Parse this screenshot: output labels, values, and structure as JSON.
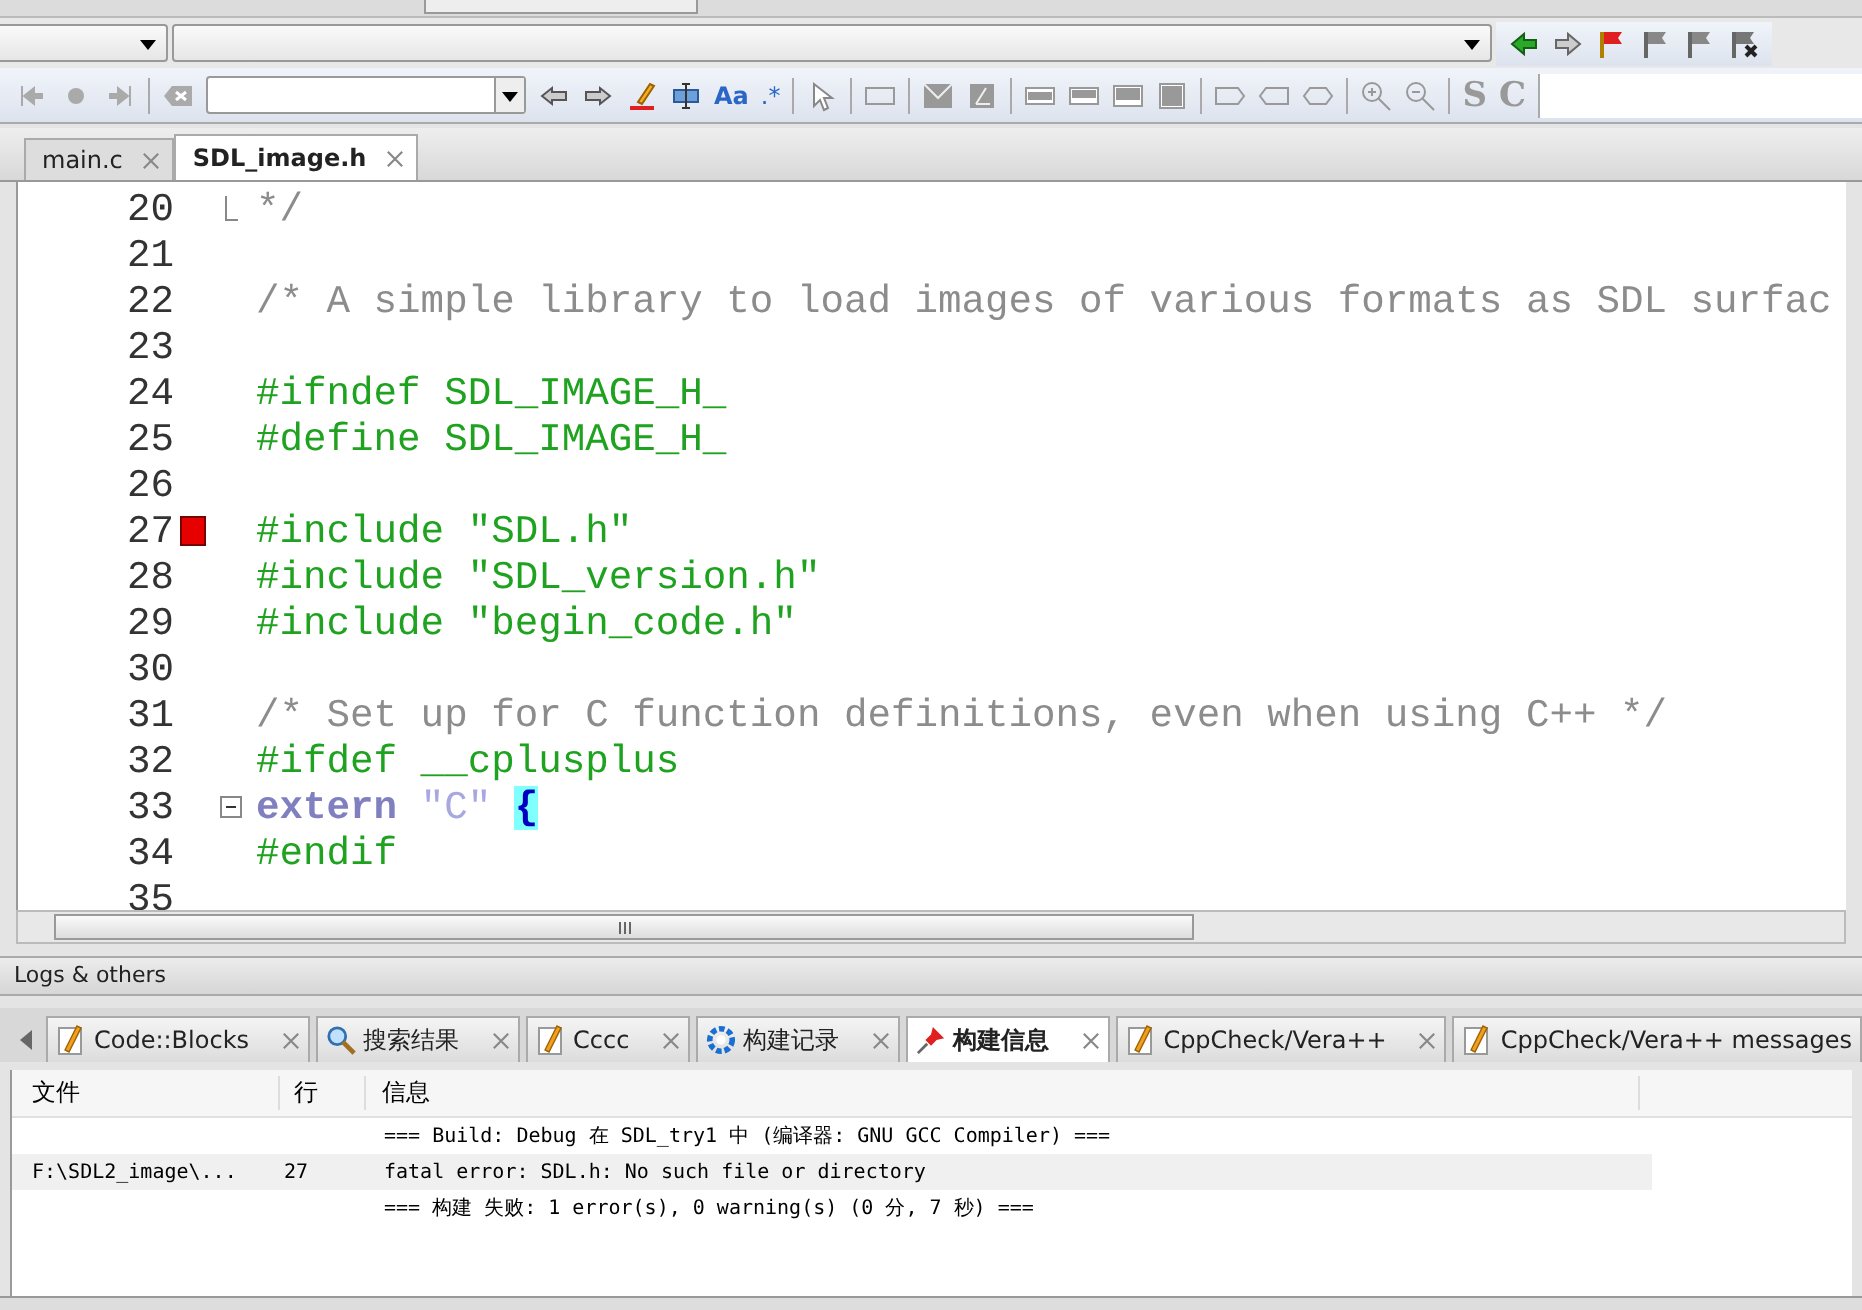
{
  "search_toolbar": {
    "match_case": "Aa",
    "regex": ".*",
    "s_button": "S",
    "c_button": "C"
  },
  "editor_tabs": [
    {
      "label": "main.c",
      "selected": false
    },
    {
      "label": "SDL_image.h",
      "selected": true
    }
  ],
  "code_lines": [
    {
      "number": "20",
      "bookmark": false,
      "kind": "foldend",
      "tokens": [
        {
          "kind": "comment",
          "text": "*/"
        }
      ]
    },
    {
      "number": "21",
      "bookmark": false,
      "kind": "plain"
    },
    {
      "number": "22",
      "bookmark": false,
      "kind": "plain",
      "tokens": [
        {
          "kind": "comment",
          "text": "/* A simple library to load images of various formats as SDL surfac"
        }
      ]
    },
    {
      "number": "23",
      "bookmark": false,
      "kind": "plain"
    },
    {
      "number": "24",
      "bookmark": false,
      "kind": "plain",
      "tokens": [
        {
          "kind": "preproc",
          "text": "#ifndef SDL_IMAGE_H_"
        }
      ]
    },
    {
      "number": "25",
      "bookmark": false,
      "kind": "plain",
      "tokens": [
        {
          "kind": "preproc",
          "text": "#define SDL_IMAGE_H_"
        }
      ]
    },
    {
      "number": "26",
      "bookmark": false,
      "kind": "plain"
    },
    {
      "number": "27",
      "bookmark": true,
      "kind": "plain",
      "tokens": [
        {
          "kind": "preproc",
          "text": "#include \"SDL.h\""
        }
      ]
    },
    {
      "number": "28",
      "bookmark": false,
      "kind": "plain",
      "tokens": [
        {
          "kind": "preproc",
          "text": "#include \"SDL_version.h\""
        }
      ]
    },
    {
      "number": "29",
      "bookmark": false,
      "kind": "plain",
      "tokens": [
        {
          "kind": "preproc",
          "text": "#include \"begin_code.h\""
        }
      ]
    },
    {
      "number": "30",
      "bookmark": false,
      "kind": "plain"
    },
    {
      "number": "31",
      "bookmark": false,
      "kind": "plain",
      "tokens": [
        {
          "kind": "comment",
          "text": "/* Set up for C function definitions, even when using C++ */"
        }
      ]
    },
    {
      "number": "32",
      "bookmark": false,
      "kind": "plain",
      "tokens": [
        {
          "kind": "preproc",
          "text": "#ifdef __cplusplus"
        }
      ]
    },
    {
      "number": "33",
      "bookmark": false,
      "kind": "foldstart",
      "tokens": [
        {
          "kind": "keyword",
          "text": "extern"
        },
        {
          "kind": "string",
          "text": "\"C\""
        },
        {
          "kind": "brace",
          "text": "{"
        }
      ]
    },
    {
      "number": "34",
      "bookmark": false,
      "kind": "plain",
      "tokens": [
        {
          "kind": "preproc",
          "text": "#endif"
        }
      ]
    },
    {
      "number": "35",
      "bookmark": false,
      "kind": "plain"
    }
  ],
  "logs_panel": {
    "title": "Logs & others",
    "tabs": [
      {
        "label": "Code::Blocks",
        "kind": "note",
        "selected": false,
        "closable": true
      },
      {
        "label": "搜索结果",
        "kind": "search",
        "selected": false,
        "closable": true
      },
      {
        "label": "Cccc",
        "kind": "note",
        "selected": false,
        "closable": true
      },
      {
        "label": "构建记录",
        "kind": "gear",
        "selected": false,
        "closable": true
      },
      {
        "label": "构建信息",
        "kind": "pin",
        "selected": true,
        "closable": true
      },
      {
        "label": "CppCheck/Vera++",
        "kind": "note",
        "selected": false,
        "closable": true
      },
      {
        "label": "CppCheck/Vera++ messages",
        "kind": "note",
        "selected": false,
        "closable": false
      }
    ],
    "columns": [
      "文件",
      "行",
      "信息"
    ],
    "rows": [
      {
        "message": "=== Build: Debug 在 SDL_try1 中 (编译器: GNU GCC Compiler) ===",
        "selected": false
      },
      {
        "file": "F:\\SDL2_image\\...",
        "line": "27",
        "message": "fatal error: SDL.h: No such file or directory",
        "selected": true
      },
      {
        "message": "=== 构建 失败: 1 error(s), 0 warning(s) (0 分, 7 秒) ===",
        "selected": false
      }
    ]
  }
}
